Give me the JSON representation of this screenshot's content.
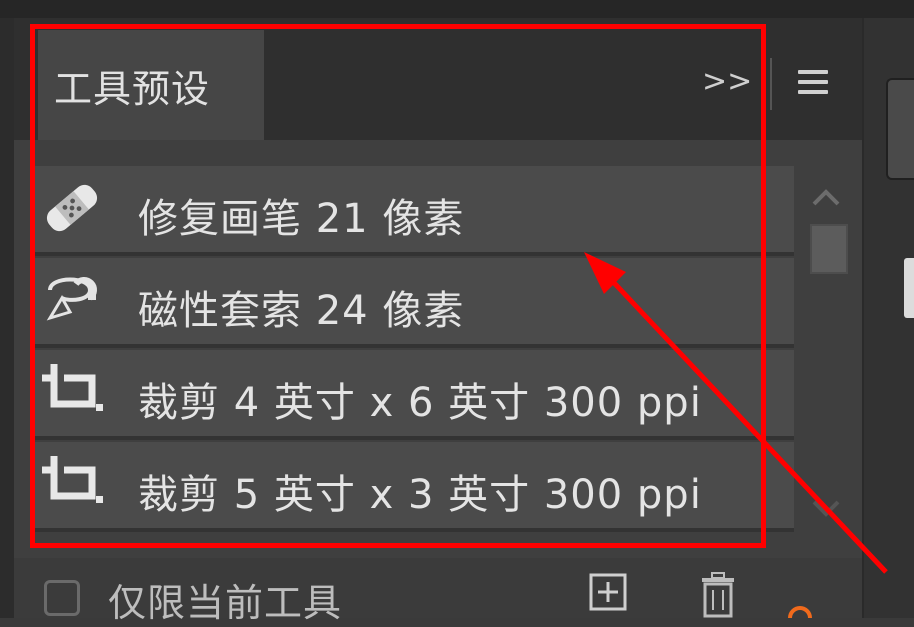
{
  "panel": {
    "tab_label": "工具预设",
    "overflow_label": ">>"
  },
  "presets": [
    {
      "label": "修复画笔 21 像素",
      "icon": "healing-brush-icon"
    },
    {
      "label": "磁性套索 24 像素",
      "icon": "magnetic-lasso-icon"
    },
    {
      "label": "裁剪 4 英寸 x 6 英寸 300 ppi",
      "icon": "crop-icon"
    },
    {
      "label": "裁剪 5 英寸 x 3 英寸 300 ppi",
      "icon": "crop-icon"
    }
  ],
  "footer": {
    "current_tool_only_label": "仅限当前工具"
  },
  "colors": {
    "annotation": "#ff0000",
    "panel_bg": "#3f3f3f",
    "row_bg": "#4b4b4b"
  }
}
